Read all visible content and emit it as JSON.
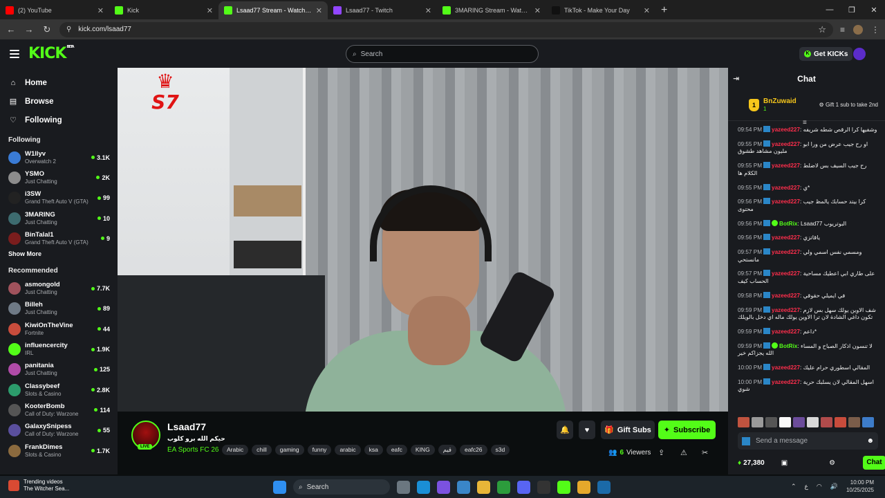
{
  "browser": {
    "tabs": [
      {
        "title": "(2) YouTube",
        "color": "#ff0000"
      },
      {
        "title": "Kick",
        "color": "#53fc18"
      },
      {
        "title": "Lsaad77 Stream - Watch Live on",
        "color": "#53fc18",
        "active": true
      },
      {
        "title": "Lsaad77 - Twitch",
        "color": "#9146ff"
      },
      {
        "title": "3MARING Stream - Watch Live",
        "color": "#53fc18"
      },
      {
        "title": "TikTok - Make Your Day",
        "color": "#111111"
      }
    ],
    "url": "kick.com/lsaad77"
  },
  "header": {
    "logo": "KICK",
    "beta": "BETA",
    "search_placeholder": "Search",
    "get_kicks": "Get KICKs"
  },
  "sidebar": {
    "nav": [
      {
        "label": "Home",
        "icon": "home-icon",
        "glyph": "⌂"
      },
      {
        "label": "Browse",
        "icon": "browse-icon",
        "glyph": "▤"
      },
      {
        "label": "Following",
        "icon": "heart-icon",
        "glyph": "♡"
      }
    ],
    "following_title": "Following",
    "following": [
      {
        "name": "W1llyv",
        "category": "Overwatch 2",
        "viewers": "3.1K",
        "color": "#3a7bd5"
      },
      {
        "name": "YSMO",
        "category": "Just Chatting",
        "viewers": "2K",
        "color": "#8c8c8c"
      },
      {
        "name": "i3SW",
        "category": "Grand Theft Auto V (GTA)",
        "viewers": "99",
        "color": "#222222"
      },
      {
        "name": "3MARING",
        "category": "Just Chatting",
        "viewers": "10",
        "color": "#3d6b6f"
      },
      {
        "name": "BinTalal1",
        "category": "Grand Theft Auto V (GTA)",
        "viewers": "9",
        "color": "#7a1d1d"
      }
    ],
    "show_more": "Show More",
    "recommended_title": "Recommended",
    "recommended": [
      {
        "name": "asmongold",
        "category": "Just Chatting",
        "viewers": "7.7K",
        "color": "#a0525c"
      },
      {
        "name": "Billeh",
        "category": "Just Chatting",
        "viewers": "89",
        "color": "#6f7a86"
      },
      {
        "name": "KiwiOnTheVine",
        "category": "Fortnite",
        "viewers": "44",
        "color": "#c84c3c"
      },
      {
        "name": "influencercity",
        "category": "IRL",
        "viewers": "1.9K",
        "color": "#53fc18"
      },
      {
        "name": "panitania",
        "category": "Just Chatting",
        "viewers": "125",
        "color": "#b04ba8"
      },
      {
        "name": "Classybeef",
        "category": "Slots & Casino",
        "viewers": "2.8K",
        "color": "#2c9c6c"
      },
      {
        "name": "KooterBomb",
        "category": "Call of Duty: Warzone",
        "viewers": "114",
        "color": "#555555"
      },
      {
        "name": "GalaxySnipess",
        "category": "Call of Duty: Warzone",
        "viewers": "55",
        "color": "#5a4f9e"
      },
      {
        "name": "FrankDimes",
        "category": "Slots & Casino",
        "viewers": "1.7K",
        "color": "#8b6a3e"
      }
    ]
  },
  "video": {
    "overlay_logo": "S7"
  },
  "stream": {
    "name": "Lsaad77",
    "title": "حيكم الله برو كلوب",
    "live": "LIVE",
    "category": "EA Sports FC 26",
    "tags": [
      "Arabic",
      "chill",
      "gaming",
      "funny",
      "arabic",
      "ksa",
      "eafc",
      "KING",
      "قيم",
      "eafc26",
      "s3d"
    ],
    "gift_subs": "Gift Subs",
    "subscribe": "Subscribe",
    "viewers": "6",
    "viewers_label": "Viewers"
  },
  "chat": {
    "title": "Chat",
    "pinned": {
      "rank": "1",
      "name": "BnZuwaid",
      "count": "1",
      "gift_text": "Gift 1 sub to take 2nd"
    },
    "messages": [
      {
        "time": "09:54 PM",
        "user": "yazeed227",
        "color": "#ff2e4c",
        "text": "وشفيها كرا الرقص شطه شريفه"
      },
      {
        "time": "09:55 PM",
        "user": "yazeed227",
        "color": "#ff2e4c",
        "text": "او رح جيب عرض من ورا ابو مليون مشاهد طشوق"
      },
      {
        "time": "09:55 PM",
        "user": "yazeed227",
        "color": "#ff2e4c",
        "text": "رح جيب السيف بس لاضلط الكلام ها"
      },
      {
        "time": "09:55 PM",
        "user": "yazeed227",
        "color": "#ff2e4c",
        "text": "*ي"
      },
      {
        "time": "09:56 PM",
        "user": "yazeed227",
        "color": "#ff2e4c",
        "text": "كرا بيتد حسابك يالمظ جيب محتوى"
      },
      {
        "time": "09:56 PM",
        "user": "BotRix",
        "color": "#53fc18",
        "bot": true,
        "text": "البوتريوب Lsaad77"
      },
      {
        "time": "09:56 PM",
        "user": "yazeed227",
        "color": "#ff2e4c",
        "text": "ياقاتزي"
      },
      {
        "time": "09:57 PM",
        "user": "yazeed227",
        "color": "#ff2e4c",
        "text": "ومسمي نفس اسمي ولي مانستحي"
      },
      {
        "time": "09:57 PM",
        "user": "yazeed227",
        "color": "#ff2e4c",
        "text": "على طاري ابي اعطيك مساحية الحساب كيف"
      },
      {
        "time": "09:58 PM",
        "user": "yazeed227",
        "color": "#ff2e4c",
        "text": "في ايميلي حقوقي"
      },
      {
        "time": "09:59 PM",
        "user": "yazeed227",
        "color": "#ff2e4c",
        "text": "شف الاوين يولك سهل بس لازم تكون داغي الشادة لان ترا الاوين يولك ماله اي دخل بالويلك"
      },
      {
        "time": "09:59 PM",
        "user": "yazeed227",
        "color": "#ff2e4c",
        "text": "*داعم"
      },
      {
        "time": "09:59 PM",
        "user": "BotRix",
        "color": "#53fc18",
        "bot": true,
        "text": "لا تنسون اذكار الصباح و المساء الله يجزاكم خير"
      },
      {
        "time": "10:00 PM",
        "user": "yazeed227",
        "color": "#ff2e4c",
        "text": "المقالي اسطوري حرام عليك"
      },
      {
        "time": "10:00 PM",
        "user": "yazeed227",
        "color": "#ff2e4c",
        "text": "اسهل المقالي لان يسلبك حرية شوي"
      }
    ],
    "send_placeholder": "Send a message",
    "kicks": "27,380",
    "chat_button": "Chat"
  },
  "taskbar": {
    "trending_title": "Trending videos",
    "trending_sub": "The Witcher Sea...",
    "search": "Search",
    "time": "10:00 PM",
    "date": "10/25/2025",
    "lang": "ع"
  }
}
